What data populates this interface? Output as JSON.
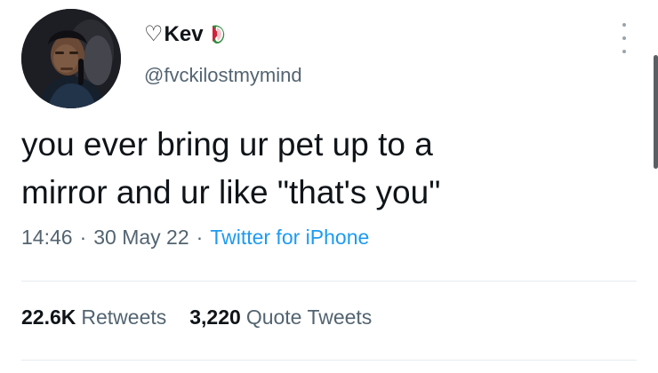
{
  "user": {
    "name_prefix": "♡",
    "display_name": "Kev",
    "flag_icon": "palestine-flag-icon",
    "handle": "@fvckilostmymind"
  },
  "tweet": {
    "line1": "you ever bring ur pet up to a",
    "line2": "mirror and ur like \"that's you\""
  },
  "meta": {
    "time": "14:46",
    "separator": "·",
    "date": "30 May 22",
    "source": "Twitter for iPhone"
  },
  "stats": {
    "retweets_count": "22.6K",
    "retweets_label": "Retweets",
    "quotes_count": "3,220",
    "quotes_label": "Quote Tweets"
  },
  "icons": {
    "more": "more-options-icon"
  },
  "colors": {
    "text": "#0f1419",
    "secondary": "#536471",
    "link": "#1d9bf0",
    "divider": "#e6ecf0"
  }
}
